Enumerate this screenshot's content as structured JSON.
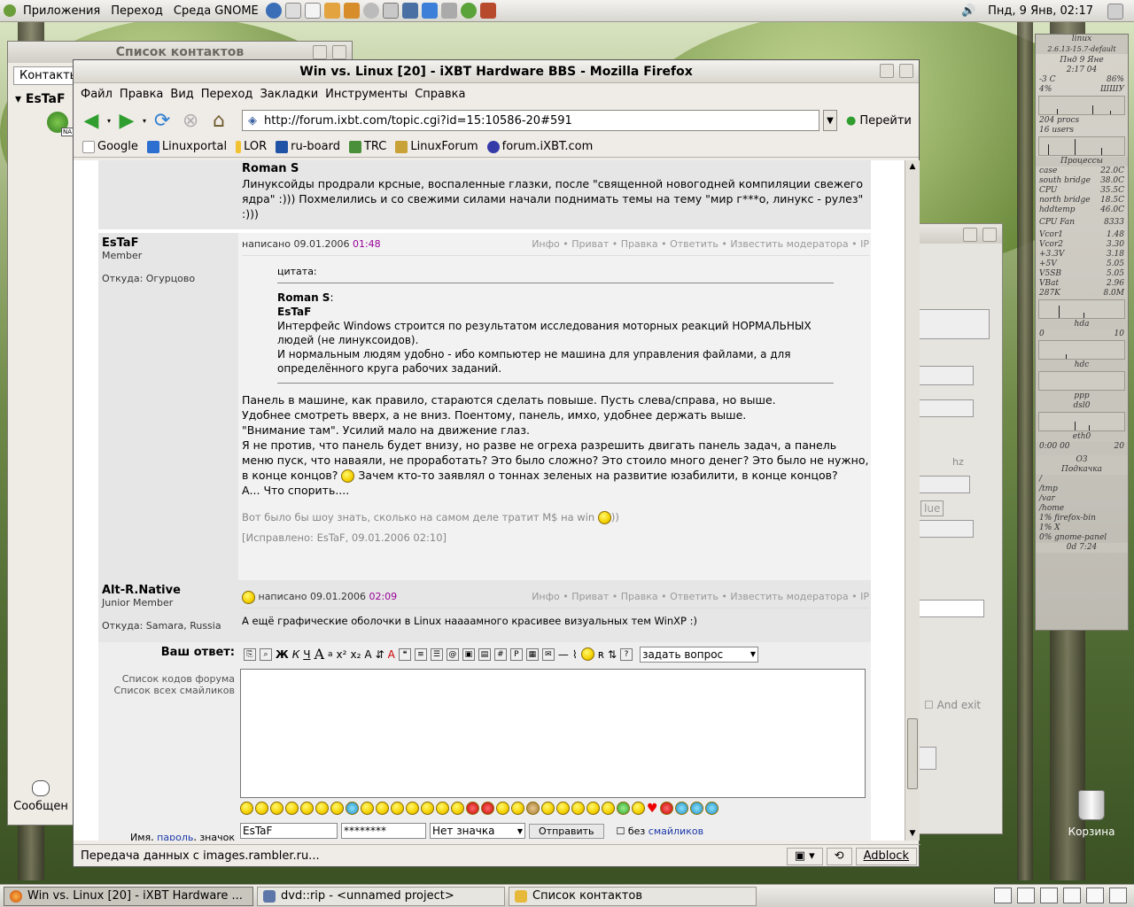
{
  "top_panel": {
    "menus": [
      "Приложения",
      "Переход",
      "Среда GNOME"
    ],
    "clock": "Пнд,   9 Янв, 02:17"
  },
  "contacts_window": {
    "title": "Список контактов",
    "tab": "Контакты",
    "contact": "EsTaF",
    "status_badge": "NA",
    "bottom_button": "Сообщен"
  },
  "firefox": {
    "title": "Win vs. Linux [20] - iXBT Hardware BBS - Mozilla Firefox",
    "menu": [
      "Файл",
      "Правка",
      "Вид",
      "Переход",
      "Закладки",
      "Инструменты",
      "Справка"
    ],
    "url": "http://forum.ixbt.com/topic.cgi?id=15:10586-20#591",
    "go_label": "Перейти",
    "bookmarks": [
      "Google",
      "Linuxportal",
      "LOR",
      "ru-board",
      "TRC",
      "LinuxForum",
      "forum.iXBT.com"
    ],
    "status_text": "Передача данных с images.rambler.ru...",
    "adblock": "Adblock"
  },
  "posts": {
    "first": {
      "author": "Roman S",
      "text": "Линуксойды продрали крсные, воспаленные глазки, после \"священной новогодней компиляции свежего ядра\" :))) Похмелились и со свежими силами начали поднимать темы на тему \"мир г***о, линукс - рулез\" :)))"
    },
    "second": {
      "author": "EsTaF",
      "rank": "Member",
      "from": "Откуда: Огурцово",
      "posted": "написано 09.01.2006",
      "time": "01:48",
      "actions": "Инфо • Приват • Правка • Ответить • Известить модератора • IP",
      "quote_header": "цитата:",
      "quote_author1": "Roman S",
      "quote_author2": "EsTaF",
      "quote_line1": "Интерфейс Windows строится по результатом исследования моторных реакций НОРМАЛЬНЫХ людей (не линуксоидов).",
      "quote_line2": "И нормальным людям удобно - ибо компьютер не машина для управления файлами, а для определённого круга рабочих заданий.",
      "p1": "Панель в машине, как правило, стараются сделать повыше. Пусть слева/справа, но выше.",
      "p2": "Удобнее смотреть вверх, а не вниз. Поентому, панель, имхо, удобнее держать выше.",
      "p3": "\"Внимание там\". Усилий мало на движение глаз.",
      "p4a": "Я не против, что панель будет внизу, но разве не огреха разрешить двигать панель задач, а панель меню пуск, что наваяли, не проработать? Это было сложно? Это стоило много денег? Это было не нужно, в конце концов?",
      "p4b": "Зачем кто-то заявлял о тоннах зеленых на развитие юзабилити, в конце концов?",
      "p5": "А... Что спорить....",
      "sig_a": "Вот было бы шоу знать, сколько на самом деле тратит M$ на win",
      "sig_b": "))",
      "edited": "[Исправлено: EsTaF, 09.01.2006 02:10]"
    },
    "third": {
      "author": "Alt-R.Native",
      "rank": "Junior Member",
      "from": "Откуда: Samara, Russia",
      "posted": "написано 09.01.2006",
      "time": "02:09",
      "actions": "Инфо • Приват • Правка • Ответить • Известить модератора • IP",
      "text": "А ещё графические оболочки в Linux наааамного красивее визуальных тем WinXP :)"
    }
  },
  "reply": {
    "label": "Ваш ответ:",
    "codes_link": "Список кодов форума",
    "smileys_link": "Список всех смайликов",
    "select": "задать вопрос",
    "name_label": "Имя,",
    "password_link": "пароль",
    "icon_label": ", значок",
    "name_value": "EsTaF",
    "password_value": "********",
    "icon_select": "Нет значка",
    "send": "Отправить",
    "no_smileys_a": "без",
    "no_smileys_b": "смайликов"
  },
  "bg_window": {
    "and_exit": "And exit",
    "hz": "hz",
    "ue": "lue"
  },
  "gkrellm": {
    "host": "linux",
    "kernel": "2.6.13-15.7-default",
    "date": "Пнд 9 Яне",
    "time": "2:17 04",
    "temp_c": "-3 C",
    "hum": "86%",
    "cpu_pct": "4%",
    "cpu_label": "ШШУ",
    "procs": "204 procs",
    "users": "16 users",
    "proc_label": "Процессы",
    "sensors": [
      [
        "case",
        "22.0C"
      ],
      [
        "south bridge",
        "38.0C"
      ],
      [
        "CPU",
        "35.5C"
      ],
      [
        "north bridge",
        "18.5C"
      ],
      [
        "hddtemp",
        "46.0C"
      ]
    ],
    "fan": [
      "CPU Fan",
      "8333"
    ],
    "volts": [
      [
        "Vcor1",
        "1.48"
      ],
      [
        "Vcor2",
        "3.30"
      ],
      [
        "+3.3V",
        "3.18"
      ],
      [
        "+5V",
        "5.05"
      ],
      [
        "V5SB",
        "5.05"
      ],
      [
        "VBat",
        "2.96"
      ]
    ],
    "mem": [
      "287K",
      "8.0M"
    ],
    "disk": [
      "hda",
      "0",
      "10"
    ],
    "hdc": "hdc",
    "ppp": "ppp",
    "dsl": "dsl0",
    "eth": "eth0",
    "uptime": "0:00 00",
    "twenty": "20",
    "oz": "ОЗ",
    "download": "Подкачка",
    "mounts": [
      "/",
      "/tmp",
      "/var",
      "/home"
    ],
    "top": [
      "1% firefox-bin",
      "1% X",
      "0% gnome-panel"
    ],
    "uptime2": "0d 7:24"
  },
  "trash": "Корзина",
  "taskbar": [
    {
      "label": "Win vs. Linux [20] - iXBT Hardware ...",
      "active": true
    },
    {
      "label": "dvd::rip - <unnamed project>",
      "active": false
    },
    {
      "label": "Список контактов",
      "active": false
    }
  ]
}
